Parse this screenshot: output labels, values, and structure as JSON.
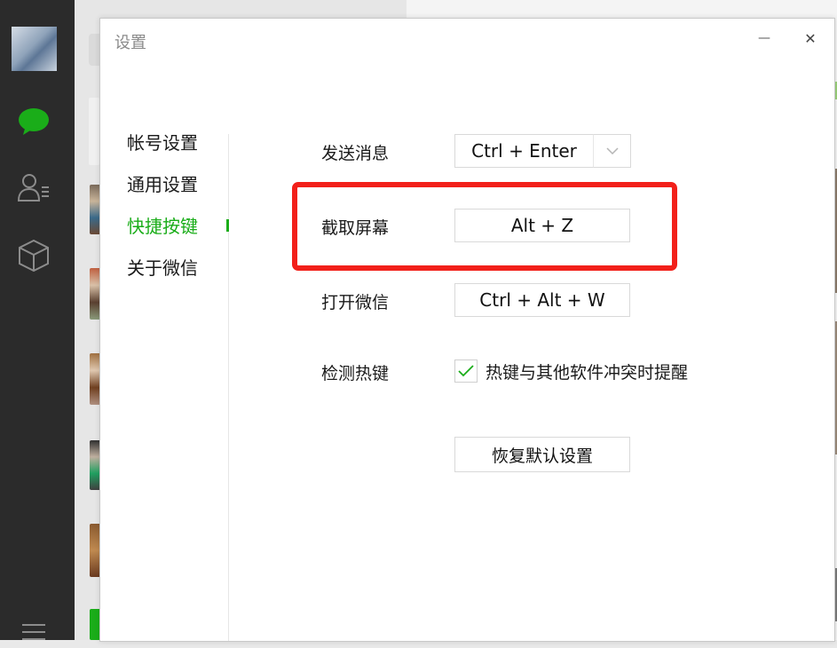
{
  "window": {
    "title": "设置"
  },
  "controls": {
    "minimize_glyph": "—",
    "close_glyph": "✕"
  },
  "nav": {
    "items": [
      {
        "label": "帐号设置"
      },
      {
        "label": "通用设置"
      },
      {
        "label": "快捷按键",
        "active": true
      },
      {
        "label": "关于微信"
      }
    ]
  },
  "shortcuts": {
    "send_message": {
      "label": "发送消息",
      "value": "Ctrl + Enter"
    },
    "screenshot": {
      "label": "截取屏幕",
      "value": "Alt + Z",
      "highlighted": true
    },
    "open_wechat": {
      "label": "打开微信",
      "value": "Ctrl + Alt + W"
    },
    "detect_hotkey": {
      "label": "检测热键",
      "checkbox_label": "热键与其他软件冲突时提醒",
      "checked": true
    }
  },
  "restore_button": {
    "label": "恢复默认设置"
  },
  "colors": {
    "accent": "#1aad19",
    "highlight": "#f2201a",
    "sidebar": "#2b2b2b"
  },
  "icons": [
    "chat-icon",
    "contacts-icon",
    "box-icon",
    "menu-icon",
    "chevron-down-icon",
    "checkmark-icon",
    "search-icon"
  ]
}
